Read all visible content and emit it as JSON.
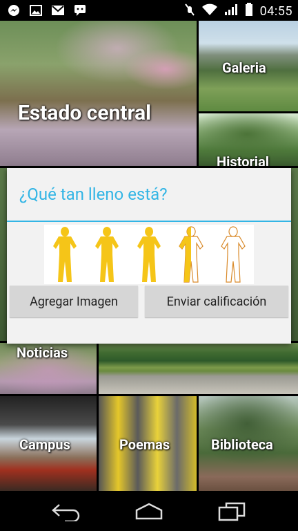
{
  "status_bar": {
    "left_icons": [
      "messenger-icon",
      "gallery-icon",
      "gmail-icon",
      "chat-icon"
    ],
    "right_icons": [
      "mute-icon",
      "wifi-icon",
      "signal-icon",
      "battery-icon"
    ],
    "time": "04:55"
  },
  "tiles": {
    "estado": "Estado central",
    "galeria": "Galeria",
    "historial": "Historial",
    "noticias": "Noticias",
    "campus": "Campus",
    "poemas": "Poemas",
    "biblioteca": "Biblioteca"
  },
  "dialog": {
    "title": "¿Qué tan lleno está?",
    "rating": {
      "value": 3.5,
      "max": 5
    },
    "buttons": {
      "add_image": "Agregar Imagen",
      "send_rating": "Enviar calificación"
    },
    "accent_color": "#33b5e5",
    "filled_color": "#f5c518"
  },
  "nav_bar": {
    "icons": [
      "back-icon",
      "home-icon",
      "recent-apps-icon"
    ]
  }
}
